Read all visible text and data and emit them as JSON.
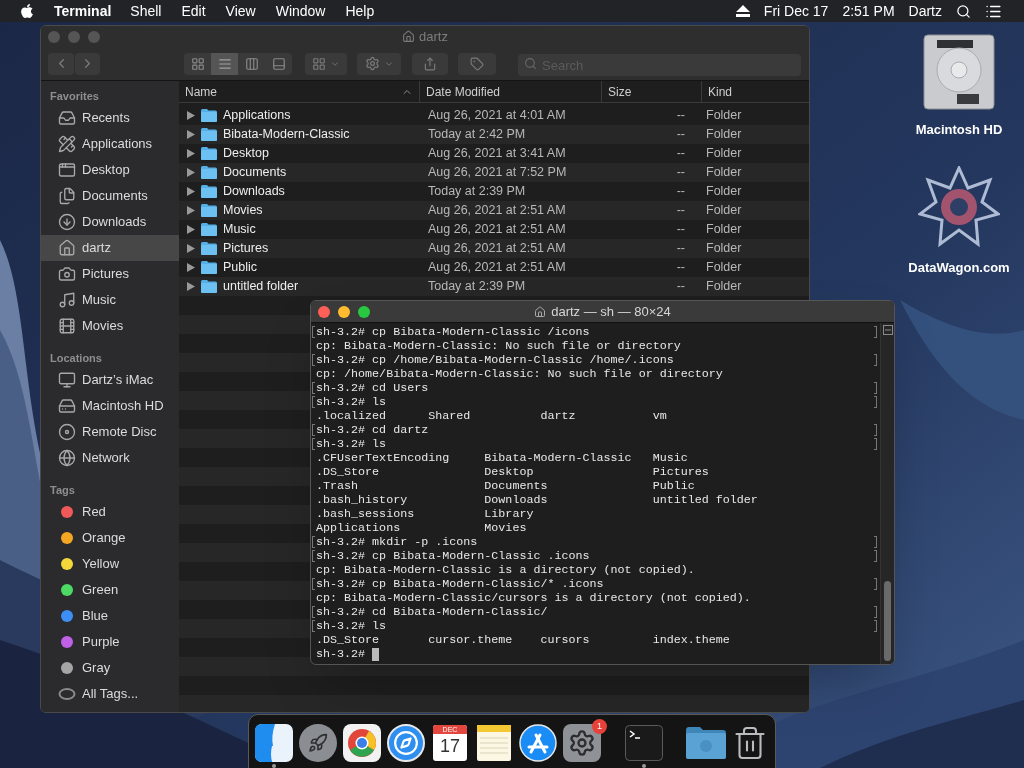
{
  "menu_bar": {
    "app": "Terminal",
    "menus": [
      "Shell",
      "Edit",
      "View",
      "Window",
      "Help"
    ],
    "date": "Fri Dec 17",
    "time": "2:51 PM",
    "user": "Dartz"
  },
  "desktop_icons": [
    {
      "kind": "drive",
      "label": "Macintosh HD"
    },
    {
      "kind": "star",
      "label": "DataWagon.com"
    }
  ],
  "finder": {
    "title": "dartz",
    "focused": false,
    "view_modes": [
      {
        "kind": "icons",
        "selected": false
      },
      {
        "kind": "list",
        "selected": true
      },
      {
        "kind": "columns",
        "selected": false
      },
      {
        "kind": "gallery",
        "selected": false
      }
    ],
    "search": {
      "placeholder": "Search"
    },
    "sidebar": [
      {
        "heading": "Favorites",
        "items": [
          {
            "kind": "recents",
            "label": "Recents",
            "selected": false
          },
          {
            "kind": "applications",
            "label": "Applications",
            "selected": false
          },
          {
            "kind": "desktop",
            "label": "Desktop",
            "selected": false
          },
          {
            "kind": "documents",
            "label": "Documents",
            "selected": false
          },
          {
            "kind": "downloads",
            "label": "Downloads",
            "selected": false
          },
          {
            "kind": "home",
            "label": "dartz",
            "selected": true
          },
          {
            "kind": "pictures",
            "label": "Pictures",
            "selected": false
          },
          {
            "kind": "music",
            "label": "Music",
            "selected": false
          },
          {
            "kind": "movies",
            "label": "Movies",
            "selected": false
          }
        ]
      },
      {
        "heading": "Locations",
        "items": [
          {
            "kind": "computer",
            "label": "Dartz’s iMac",
            "selected": false
          },
          {
            "kind": "drive",
            "label": "Macintosh HD",
            "selected": false
          },
          {
            "kind": "disc",
            "label": "Remote Disc",
            "selected": false
          },
          {
            "kind": "network",
            "label": "Network",
            "selected": false
          }
        ]
      },
      {
        "heading": "Tags",
        "items": [
          {
            "kind": "tag",
            "label": "Red",
            "color": "#f0585a",
            "selected": false
          },
          {
            "kind": "tag",
            "label": "Orange",
            "color": "#f5a623",
            "selected": false
          },
          {
            "kind": "tag",
            "label": "Yellow",
            "color": "#f4d83a",
            "selected": false
          },
          {
            "kind": "tag",
            "label": "Green",
            "color": "#4cd964",
            "selected": false
          },
          {
            "kind": "tag",
            "label": "Blue",
            "color": "#3d8ff5",
            "selected": false
          },
          {
            "kind": "tag",
            "label": "Purple",
            "color": "#c061e8",
            "selected": false
          },
          {
            "kind": "tag",
            "label": "Gray",
            "color": "#a5a5a5",
            "selected": false
          },
          {
            "kind": "all_tags",
            "label": "All Tags...",
            "selected": false
          }
        ]
      }
    ],
    "columns": [
      {
        "label": "Name",
        "sorted": true
      },
      {
        "label": "Date Modified",
        "sorted": false
      },
      {
        "label": "Size",
        "sorted": false
      },
      {
        "label": "Kind",
        "sorted": false
      }
    ],
    "rows": [
      {
        "name": "Applications",
        "date": "Aug 26, 2021 at 4:01 AM",
        "size": "--",
        "kind": "Folder",
        "expanded": false
      },
      {
        "name": "Bibata-Modern-Classic",
        "date": "Today at 2:42 PM",
        "size": "--",
        "kind": "Folder",
        "expanded": false
      },
      {
        "name": "Desktop",
        "date": "Aug 26, 2021 at 3:41 AM",
        "size": "--",
        "kind": "Folder",
        "expanded": false
      },
      {
        "name": "Documents",
        "date": "Aug 26, 2021 at 7:52 PM",
        "size": "--",
        "kind": "Folder",
        "expanded": false
      },
      {
        "name": "Downloads",
        "date": "Today at 2:39 PM",
        "size": "--",
        "kind": "Folder",
        "expanded": false
      },
      {
        "name": "Movies",
        "date": "Aug 26, 2021 at 2:51 AM",
        "size": "--",
        "kind": "Folder",
        "expanded": false
      },
      {
        "name": "Music",
        "date": "Aug 26, 2021 at 2:51 AM",
        "size": "--",
        "kind": "Folder",
        "expanded": false
      },
      {
        "name": "Pictures",
        "date": "Aug 26, 2021 at 2:51 AM",
        "size": "--",
        "kind": "Folder",
        "expanded": false
      },
      {
        "name": "Public",
        "date": "Aug 26, 2021 at 2:51 AM",
        "size": "--",
        "kind": "Folder",
        "expanded": false
      },
      {
        "name": "untitled folder",
        "date": "Today at 2:39 PM",
        "size": "--",
        "kind": "Folder",
        "expanded": false
      }
    ]
  },
  "terminal": {
    "title": "dartz — sh — 80×24",
    "focused": true,
    "cursor": true,
    "lines": [
      {
        "text": "sh-3.2# cp Bibata-Modern-Classic /icons",
        "marked": true
      },
      {
        "text": "cp: Bibata-Modern-Classic: No such file or directory",
        "marked": false
      },
      {
        "text": "sh-3.2# cp /home/Bibata-Modern-Classic /home/.icons",
        "marked": true
      },
      {
        "text": "cp: /home/Bibata-Modern-Classic: No such file or directory",
        "marked": false
      },
      {
        "text": "sh-3.2# cd Users",
        "marked": true
      },
      {
        "text": "sh-3.2# ls",
        "marked": true
      },
      {
        "text": ".localized      Shared          dartz           vm",
        "marked": false
      },
      {
        "text": "sh-3.2# cd dartz",
        "marked": true
      },
      {
        "text": "sh-3.2# ls",
        "marked": true
      },
      {
        "text": ".CFUserTextEncoding     Bibata-Modern-Classic   Music",
        "marked": false
      },
      {
        "text": ".DS_Store               Desktop                 Pictures",
        "marked": false
      },
      {
        "text": ".Trash                  Documents               Public",
        "marked": false
      },
      {
        "text": ".bash_history           Downloads               untitled folder",
        "marked": false
      },
      {
        "text": ".bash_sessions          Library",
        "marked": false
      },
      {
        "text": "Applications            Movies",
        "marked": false
      },
      {
        "text": "sh-3.2# mkdir -p .icons",
        "marked": true
      },
      {
        "text": "sh-3.2# cp Bibata-Modern-Classic .icons",
        "marked": true
      },
      {
        "text": "cp: Bibata-Modern-Classic is a directory (not copied).",
        "marked": false
      },
      {
        "text": "sh-3.2# cp Bibata-Modern-Classic/* .icons",
        "marked": true
      },
      {
        "text": "cp: Bibata-Modern-Classic/cursors is a directory (not copied).",
        "marked": false
      },
      {
        "text": "sh-3.2# cd Bibata-Modern-Classic/",
        "marked": true
      },
      {
        "text": "sh-3.2# ls",
        "marked": true
      },
      {
        "text": ".DS_Store       cursor.theme    cursors         index.theme",
        "marked": false
      },
      {
        "text": "sh-3.2# ",
        "marked": false
      }
    ]
  },
  "dock": {
    "groups": [
      [
        {
          "kind": "finder",
          "running": true
        },
        {
          "kind": "launchpad",
          "running": false
        },
        {
          "kind": "chrome",
          "running": false
        },
        {
          "kind": "safari",
          "running": false
        },
        {
          "kind": "calendar",
          "running": false,
          "month": "DEC",
          "day": "17"
        },
        {
          "kind": "notes",
          "running": false
        },
        {
          "kind": "appstore",
          "running": false
        },
        {
          "kind": "settings",
          "running": false,
          "badge": "1"
        }
      ],
      [
        {
          "kind": "terminal",
          "running": true
        }
      ],
      [
        {
          "kind": "folder",
          "running": false
        },
        {
          "kind": "trash",
          "running": false
        }
      ]
    ]
  }
}
